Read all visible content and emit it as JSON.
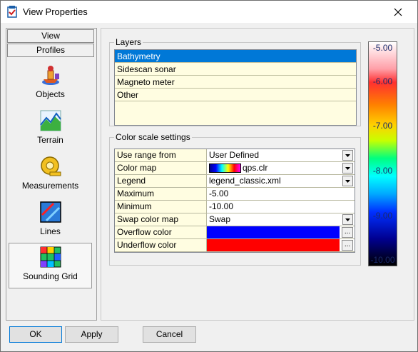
{
  "window": {
    "title": "View Properties"
  },
  "sidebar": {
    "top_buttons": [
      "View",
      "Profiles"
    ],
    "items": [
      {
        "label": "Objects"
      },
      {
        "label": "Terrain"
      },
      {
        "label": "Measurements"
      },
      {
        "label": "Lines"
      },
      {
        "label": "Sounding Grid",
        "selected": true
      }
    ]
  },
  "layers_group": {
    "title": "Layers",
    "items": [
      "Bathymetry",
      "Sidescan sonar",
      "Magneto meter",
      "Other"
    ],
    "selected_index": 0
  },
  "color_scale": {
    "title": "Color scale settings",
    "rows": [
      {
        "label": "Use range from",
        "value": "User Defined"
      },
      {
        "label": "Color map",
        "value": "qps.clr"
      },
      {
        "label": "Legend",
        "value": "legend_classic.xml"
      },
      {
        "label": "Maximum",
        "value": "-5.00"
      },
      {
        "label": "Minimum",
        "value": "-10.00"
      },
      {
        "label": "Swap color map",
        "value": "Swap"
      },
      {
        "label": "Overflow color",
        "value": "",
        "color": "#0000ff"
      },
      {
        "label": "Underflow color",
        "value": "",
        "color": "#ff0000"
      }
    ],
    "ellipsis": "...",
    "legend_ticks": [
      "-5.00",
      "-6.00",
      "-7.00",
      "-8.00",
      "-9.00",
      "-10.00"
    ]
  },
  "buttons": {
    "ok": "OK",
    "apply": "Apply",
    "cancel": "Cancel"
  }
}
